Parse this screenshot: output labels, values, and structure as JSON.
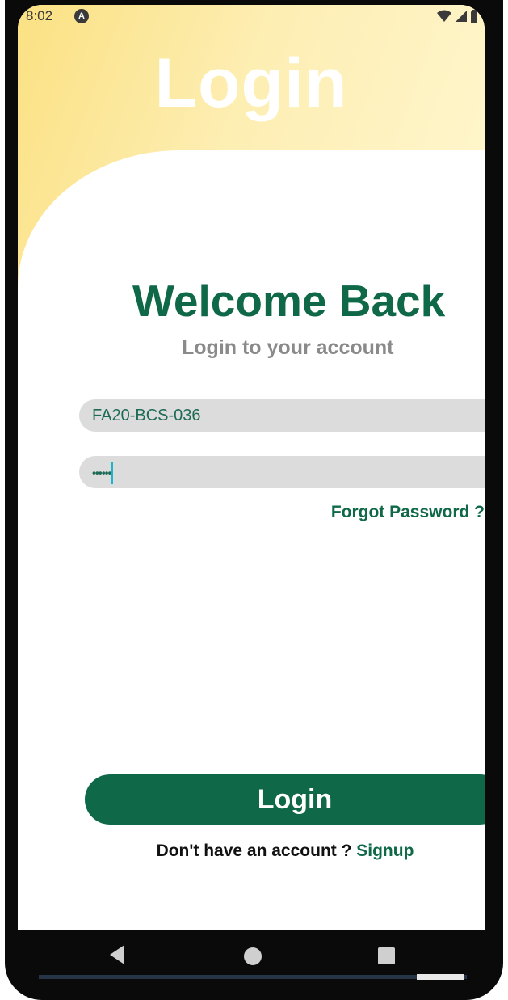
{
  "status_bar": {
    "time": "8:02",
    "app_icon": "A"
  },
  "header": {
    "title": "Login"
  },
  "welcome": {
    "title": "Welcome Back",
    "subtitle": "Login to your account"
  },
  "form": {
    "username_value": "FA20-BCS-036",
    "password_mask": "••••••",
    "forgot_label": "Forgot Password ?"
  },
  "actions": {
    "login_label": "Login"
  },
  "signup": {
    "prompt": "Don't have an account ?",
    "link": "Signup"
  },
  "nav": {
    "icons": [
      "back-icon",
      "home-icon",
      "recents-icon"
    ]
  },
  "colors": {
    "primary": "#0f6847",
    "header_gradient_start": "#fbe183",
    "header_gradient_end": "#fff7d0",
    "input_bg": "#dcdcdc"
  }
}
